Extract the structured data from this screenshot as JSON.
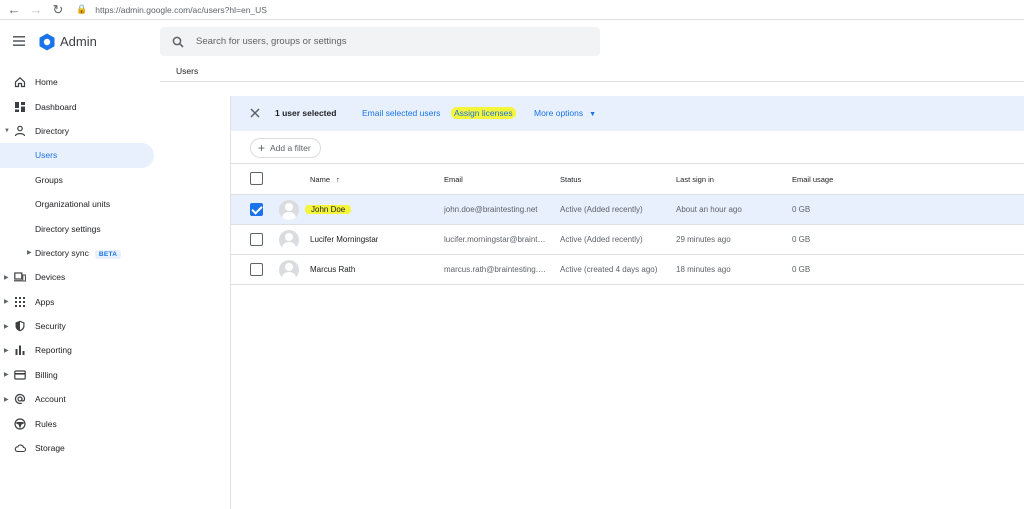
{
  "browser": {
    "url": "https://admin.google.com/ac/users?hl=en_US"
  },
  "header": {
    "app_name": "Admin",
    "search_placeholder": "Search for users, groups or settings"
  },
  "breadcrumb": "Users",
  "sidebar": {
    "items": [
      {
        "label": "Home"
      },
      {
        "label": "Dashboard"
      },
      {
        "label": "Directory"
      },
      {
        "label": "Users"
      },
      {
        "label": "Groups"
      },
      {
        "label": "Organizational units"
      },
      {
        "label": "Directory settings"
      },
      {
        "label": "Directory sync",
        "badge": "BETA"
      },
      {
        "label": "Devices"
      },
      {
        "label": "Apps"
      },
      {
        "label": "Security"
      },
      {
        "label": "Reporting"
      },
      {
        "label": "Billing"
      },
      {
        "label": "Account"
      },
      {
        "label": "Rules"
      },
      {
        "label": "Storage"
      }
    ]
  },
  "action_bar": {
    "selected_text": "1 user selected",
    "email_selected": "Email selected users",
    "assign_licenses": "Assign licenses",
    "more_options": "More options"
  },
  "filter": {
    "add_filter": "Add a filter"
  },
  "table": {
    "columns": [
      "Name",
      "Email",
      "Status",
      "Last sign in",
      "Email usage"
    ],
    "rows": [
      {
        "name": "John Doe",
        "email": "john.doe@braintesting.net",
        "status": "Active (Added recently)",
        "last_sign_in": "About an hour ago",
        "usage": "0 GB",
        "selected": true
      },
      {
        "name": "Lucifer Morningstar",
        "email": "lucifer.morningstar@braintesting.net",
        "status": "Active (Added recently)",
        "last_sign_in": "29 minutes ago",
        "usage": "0 GB",
        "selected": false
      },
      {
        "name": "Marcus Rath",
        "email": "marcus.rath@braintesting.net",
        "status": "Active (created 4 days ago)",
        "last_sign_in": "18 minutes ago",
        "usage": "0 GB",
        "selected": false
      }
    ]
  },
  "colors": {
    "accent": "#1a73e8",
    "selection_bg": "#e8f0fe",
    "highlight": "#f5f53a"
  }
}
